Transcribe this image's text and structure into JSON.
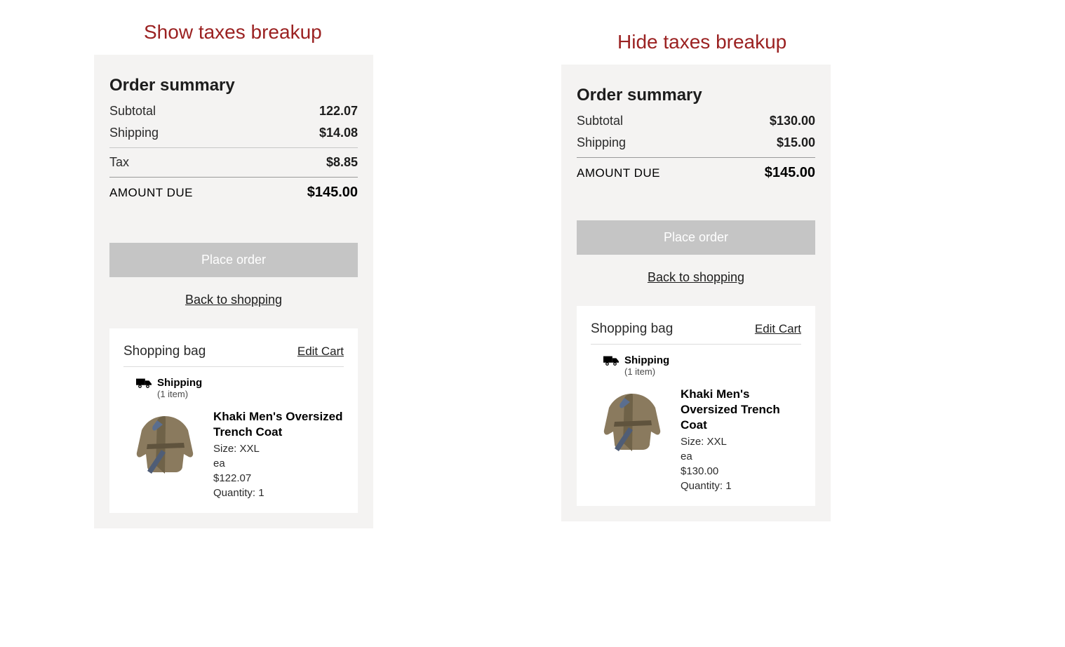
{
  "titles": {
    "show": "Show taxes breakup",
    "hide": "Hide taxes breakup"
  },
  "left": {
    "order_summary_title": "Order summary",
    "subtotal_label": "Subtotal",
    "subtotal_value": "122.07",
    "shipping_label": "Shipping",
    "shipping_value": "$14.08",
    "tax_label": "Tax",
    "tax_value": "$8.85",
    "amount_due_label": "AMOUNT DUE",
    "amount_due_value": "$145.00",
    "place_order_label": "Place order",
    "back_label": "Back to shopping",
    "bag_title": "Shopping bag",
    "edit_cart": "Edit Cart",
    "shipping_header": "Shipping",
    "shipping_count": "(1 item)",
    "product": {
      "name": "Khaki Men's Oversized Trench Coat",
      "size": "Size: XXL",
      "unit": "ea",
      "price": "$122.07",
      "qty": "Quantity: 1"
    }
  },
  "right": {
    "order_summary_title": "Order summary",
    "subtotal_label": "Subtotal",
    "subtotal_value": "$130.00",
    "shipping_label": "Shipping",
    "shipping_value": "$15.00",
    "amount_due_label": "AMOUNT DUE",
    "amount_due_value": "$145.00",
    "place_order_label": "Place order",
    "back_label": "Back to shopping",
    "bag_title": "Shopping bag",
    "edit_cart": "Edit Cart",
    "shipping_header": "Shipping",
    "shipping_count": "(1 item)",
    "product": {
      "name": "Khaki Men's Oversized Trench Coat",
      "size": "Size: XXL",
      "unit": "ea",
      "price": "$130.00",
      "qty": "Quantity: 1"
    }
  }
}
